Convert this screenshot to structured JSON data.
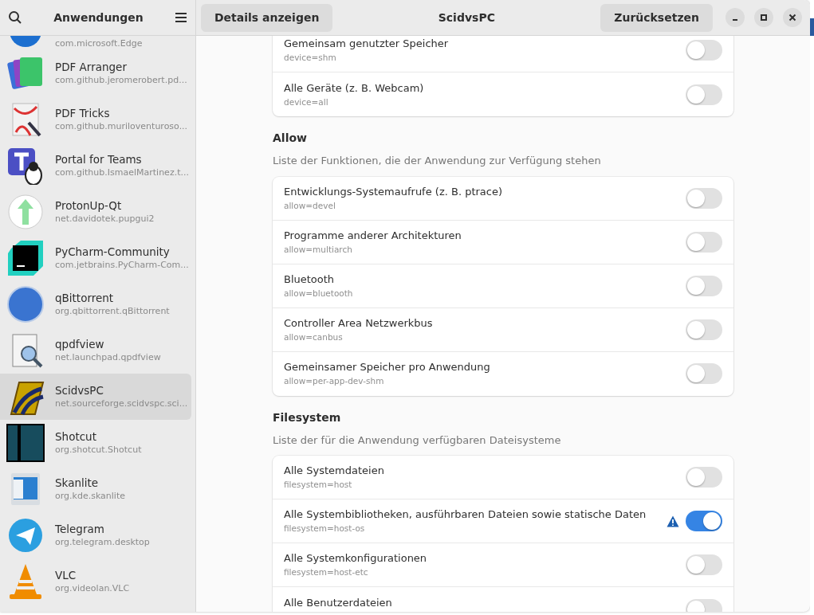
{
  "sidebar": {
    "title": "Anwendungen",
    "apps": [
      {
        "id": "com.microsoft.Edge",
        "selected": false
      },
      {
        "name": "PDF Arranger",
        "id": "com.github.jeromerobert.pd...",
        "selected": false
      },
      {
        "name": "PDF Tricks",
        "id": "com.github.muriloventuroso...",
        "selected": false
      },
      {
        "name": "Portal for Teams",
        "id": "com.github.IsmaelMartinez.t...",
        "selected": false
      },
      {
        "name": "ProtonUp-Qt",
        "id": "net.davidotek.pupgui2",
        "selected": false
      },
      {
        "name": "PyCharm-Community",
        "id": "com.jetbrains.PyCharm-Com...",
        "selected": false
      },
      {
        "name": "qBittorrent",
        "id": "org.qbittorrent.qBittorrent",
        "selected": false
      },
      {
        "name": "qpdfview",
        "id": "net.launchpad.qpdfview",
        "selected": false
      },
      {
        "name": "ScidvsPC",
        "id": "net.sourceforge.scidvspc.sci...",
        "selected": true
      },
      {
        "name": "Shotcut",
        "id": "org.shotcut.Shotcut",
        "selected": false
      },
      {
        "name": "Skanlite",
        "id": "org.kde.skanlite",
        "selected": false
      },
      {
        "name": "Telegram",
        "id": "org.telegram.desktop",
        "selected": false
      },
      {
        "name": "VLC",
        "id": "org.videolan.VLC",
        "selected": false
      }
    ]
  },
  "header": {
    "details_button": "Details anzeigen",
    "title": "ScidvsPC",
    "reset_button": "Zurücksetzen"
  },
  "sections": [
    {
      "rows": [
        {
          "label": "Gemeinsam genutzter Speicher",
          "key": "device=shm",
          "on": false,
          "warning": false
        },
        {
          "label": "Alle Geräte (z. B. Webcam)",
          "key": "device=all",
          "on": false,
          "warning": false
        }
      ]
    },
    {
      "title": "Allow",
      "description": "Liste der Funktionen, die der Anwendung zur Verfügung stehen",
      "rows": [
        {
          "label": "Entwicklungs-Systemaufrufe (z. B. ptrace)",
          "key": "allow=devel",
          "on": false,
          "warning": false
        },
        {
          "label": "Programme anderer Architekturen",
          "key": "allow=multiarch",
          "on": false,
          "warning": false
        },
        {
          "label": "Bluetooth",
          "key": "allow=bluetooth",
          "on": false,
          "warning": false
        },
        {
          "label": "Controller Area Netzwerkbus",
          "key": "allow=canbus",
          "on": false,
          "warning": false
        },
        {
          "label": "Gemeinsamer Speicher pro Anwendung",
          "key": "allow=per-app-dev-shm",
          "on": false,
          "warning": false
        }
      ]
    },
    {
      "title": "Filesystem",
      "description": "Liste der für die Anwendung verfügbaren Dateisysteme",
      "rows": [
        {
          "label": "Alle Systemdateien",
          "key": "filesystem=host",
          "on": false,
          "warning": false
        },
        {
          "label": "Alle Systembibliotheken, ausführbaren Dateien sowie statische Daten",
          "key": "filesystem=host-os",
          "on": true,
          "warning": true
        },
        {
          "label": "Alle Systemkonfigurationen",
          "key": "filesystem=host-etc",
          "on": false,
          "warning": false
        },
        {
          "label": "Alle Benutzerdateien",
          "on": false,
          "warning": false
        }
      ]
    }
  ]
}
